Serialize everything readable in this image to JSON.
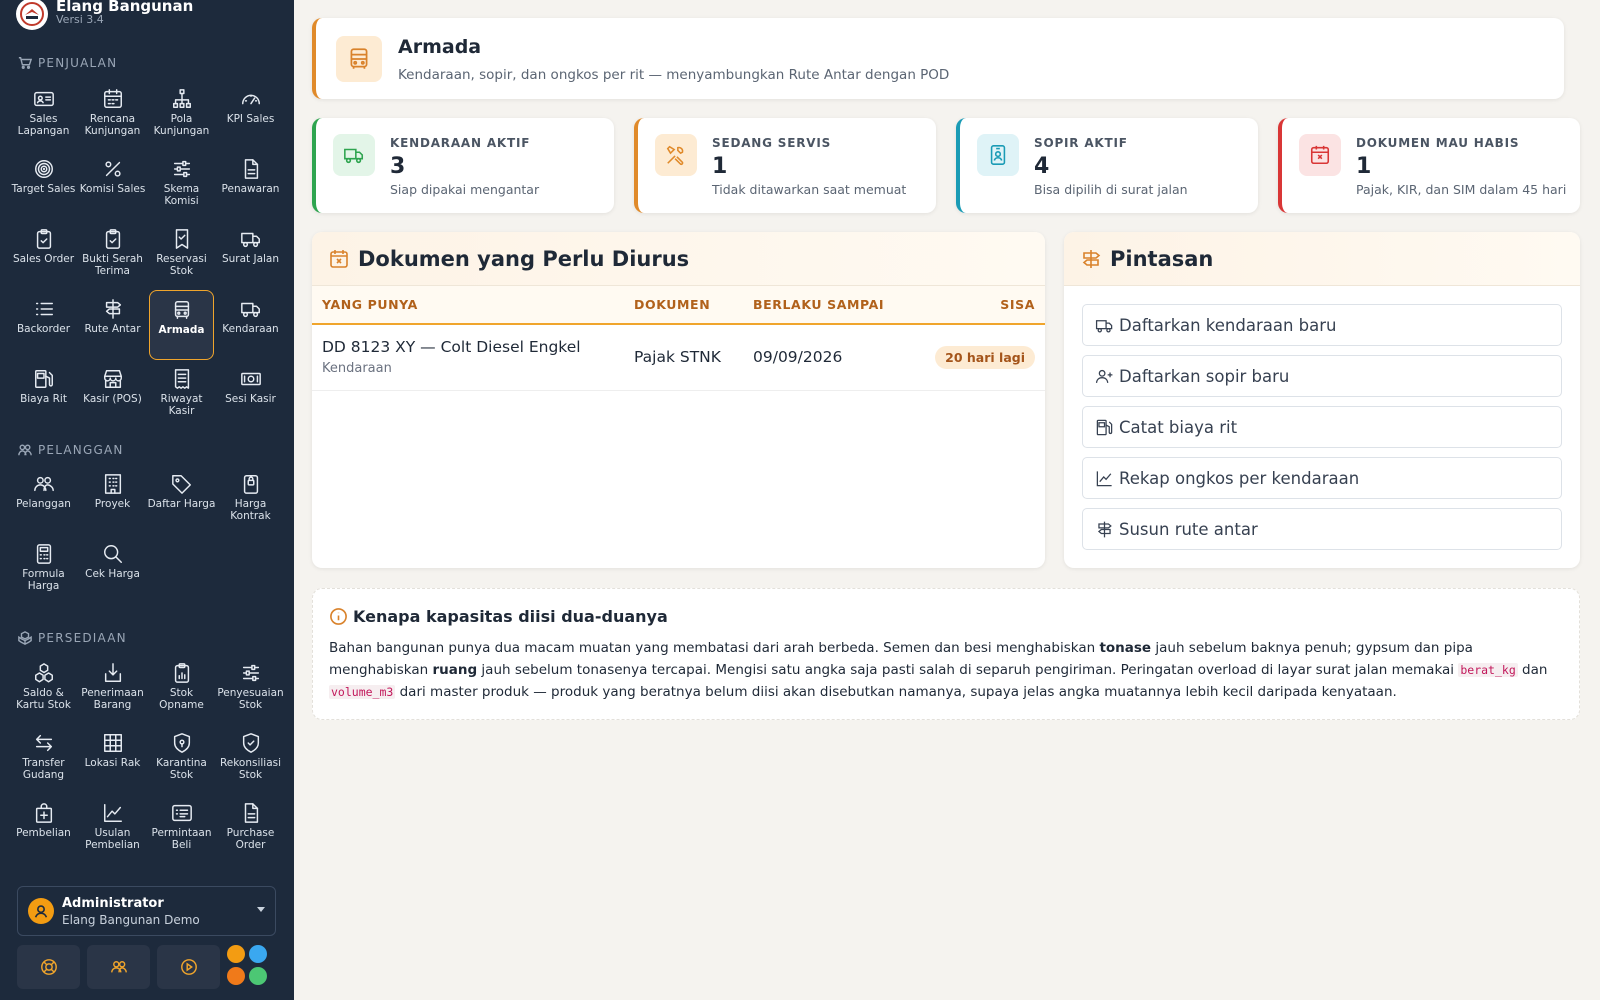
{
  "brand": {
    "name": "Elang Bangunan",
    "version": "Versi 3.4"
  },
  "sections": [
    {
      "title": "PENJUALAN",
      "items": [
        {
          "label": "Sales Lapangan",
          "icon": "id-card-icon"
        },
        {
          "label": "Rencana Kunjungan",
          "icon": "calendar-icon"
        },
        {
          "label": "Pola Kunjungan",
          "icon": "diagram-icon"
        },
        {
          "label": "KPI Sales",
          "icon": "speedometer-icon"
        },
        {
          "label": "Target Sales",
          "icon": "target-icon"
        },
        {
          "label": "Komisi Sales",
          "icon": "percent-icon"
        },
        {
          "label": "Skema Komisi",
          "icon": "sliders-icon"
        },
        {
          "label": "Penawaran",
          "icon": "document-icon"
        },
        {
          "label": "Sales Order",
          "icon": "clipboard-check-icon"
        },
        {
          "label": "Bukti Serah Terima",
          "icon": "clipboard-check-icon"
        },
        {
          "label": "Reservasi Stok",
          "icon": "bookmark-check-icon"
        },
        {
          "label": "Surat Jalan",
          "icon": "truck-icon"
        },
        {
          "label": "Backorder",
          "icon": "list-icon"
        },
        {
          "label": "Rute Antar",
          "icon": "signpost-icon"
        },
        {
          "label": "Armada",
          "icon": "bus-icon",
          "active": true
        },
        {
          "label": "Kendaraan",
          "icon": "truck-icon"
        },
        {
          "label": "Biaya Rit",
          "icon": "fuel-pump-icon"
        },
        {
          "label": "Kasir (POS)",
          "icon": "shop-icon"
        },
        {
          "label": "Riwayat Kasir",
          "icon": "receipt-icon"
        },
        {
          "label": "Sesi Kasir",
          "icon": "cash-icon"
        }
      ]
    },
    {
      "title": "PELANGGAN",
      "items": [
        {
          "label": "Pelanggan",
          "icon": "people-icon"
        },
        {
          "label": "Proyek",
          "icon": "building-icon"
        },
        {
          "label": "Daftar Harga",
          "icon": "tag-icon"
        },
        {
          "label": "Harga Kontrak",
          "icon": "lock-icon"
        },
        {
          "label": "Formula Harga",
          "icon": "calculator-icon"
        },
        {
          "label": "Cek Harga",
          "icon": "search-icon"
        }
      ]
    },
    {
      "title": "PERSEDIAAN",
      "items": [
        {
          "label": "Saldo & Kartu Stok",
          "icon": "boxes-icon"
        },
        {
          "label": "Penerimaan Barang",
          "icon": "box-arrow-in-icon"
        },
        {
          "label": "Stok Opname",
          "icon": "clipboard-data-icon"
        },
        {
          "label": "Penyesuaian Stok",
          "icon": "sliders-icon"
        },
        {
          "label": "Transfer Gudang",
          "icon": "arrows-exchange-icon"
        },
        {
          "label": "Lokasi Rak",
          "icon": "grid-icon"
        },
        {
          "label": "Karantina Stok",
          "icon": "shield-lock-icon"
        },
        {
          "label": "Rekonsiliasi Stok",
          "icon": "shield-check-icon"
        },
        {
          "label": "Pembelian",
          "icon": "bag-plus-icon"
        },
        {
          "label": "Usulan Pembelian",
          "icon": "graph-up-icon"
        },
        {
          "label": "Permintaan Beli",
          "icon": "card-list-icon"
        },
        {
          "label": "Purchase Order",
          "icon": "document-icon"
        }
      ]
    }
  ],
  "user": {
    "name": "Administrator",
    "org": "Elang Bangunan Demo"
  },
  "header": {
    "title": "Armada",
    "subtitle": "Kendaraan, sopir, dan ongkos per rit — menyambungkan Rute Antar dengan POD"
  },
  "stats": [
    {
      "label": "KENDARAAN AKTIF",
      "value": "3",
      "desc": "Siap dipakai mengantar",
      "color": "#2ea44f",
      "bg": "#e3f5e8",
      "icon": "truck-icon"
    },
    {
      "label": "SEDANG SERVIS",
      "value": "1",
      "desc": "Tidak ditawarkan saat memuat",
      "color": "#e08a2a",
      "bg": "#fdebd3",
      "icon": "tools-icon"
    },
    {
      "label": "SOPIR AKTIF",
      "value": "4",
      "desc": "Bisa dipilih di surat jalan",
      "color": "#1a9bb5",
      "bg": "#dff3f7",
      "icon": "person-badge-icon"
    },
    {
      "label": "DOKUMEN MAU HABIS",
      "value": "1",
      "desc": "Pajak, KIR, dan SIM dalam 45 hari",
      "color": "#d93636",
      "bg": "#fbe3e3",
      "icon": "calendar-x-icon"
    }
  ],
  "docs": {
    "title": "Dokumen yang Perlu Diurus",
    "columns": [
      "YANG PUNYA",
      "DOKUMEN",
      "BERLAKU SAMPAI",
      "SISA"
    ],
    "rows": [
      {
        "owner": "DD 8123 XY — Colt Diesel Engkel",
        "owner_type": "Kendaraan",
        "document": "Pajak STNK",
        "valid_until": "09/09/2026",
        "remaining": "20 hari lagi"
      }
    ]
  },
  "shortcuts": {
    "title": "Pintasan",
    "items": [
      {
        "label": "Daftarkan kendaraan baru",
        "icon": "truck-icon"
      },
      {
        "label": "Daftarkan sopir baru",
        "icon": "person-plus-icon"
      },
      {
        "label": "Catat biaya rit",
        "icon": "fuel-pump-icon"
      },
      {
        "label": "Rekap ongkos per kendaraan",
        "icon": "graph-up-icon"
      },
      {
        "label": "Susun rute antar",
        "icon": "signpost-icon"
      }
    ]
  },
  "info": {
    "title": "Kenapa kapasitas diisi dua-duanya",
    "p1": "Bahan bangunan punya dua macam muatan yang membatasi dari arah berbeda. Semen dan besi menghabiskan ",
    "b1": "tonase",
    "p2": " jauh sebelum baknya penuh; gypsum dan pipa menghabiskan ",
    "b2": "ruang",
    "p3": " jauh sebelum tonasenya tercapai. Mengisi satu angka saja pasti salah di separuh pengiriman. Peringatan overload di layar surat jalan memakai ",
    "c1": "berat_kg",
    "p4": " dan ",
    "c2": "volume_m3",
    "p5": " dari master produk — produk yang beratnya belum diisi akan disebutkan namanya, supaya jelas angka muatannya lebih kecil daripada kenyataan."
  },
  "theme": {
    "accent": "#f0a52c",
    "sidebar_bg": "#1d2a3c"
  },
  "color_dots": [
    "#f39c12",
    "#3aa8f0",
    "#f07a1a",
    "#4cc774"
  ]
}
